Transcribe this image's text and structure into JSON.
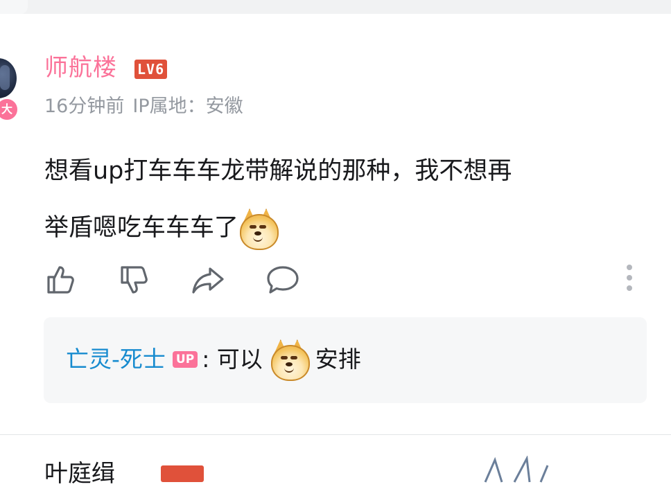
{
  "comment": {
    "username": "师航楼",
    "level": "LV6",
    "vip_badge": "大",
    "time": "16分钟前",
    "ip": "IP属地：安徽",
    "content_line1": "想看up打车车车龙带解说的那种，我不想再",
    "content_line2": "举盾嗯吃车车车了",
    "emoji": "doge-emoji"
  },
  "actions": {
    "like": "thumbs-up-icon",
    "dislike": "thumbs-down-icon",
    "share": "share-icon",
    "reply": "comment-icon",
    "more": "more-vertical-icon"
  },
  "reply": {
    "username": "亡灵-死士",
    "up_tag": "UP",
    "text_before": ": 可以",
    "text_after": "安排"
  },
  "next_comment": {
    "username_partial": "叶庭缉"
  },
  "colors": {
    "username_pink": "#fb7299",
    "level_red": "#e0513a",
    "reply_user_blue": "#178bcf",
    "meta_gray": "#9499a0",
    "reply_bg": "#f6f7f8"
  }
}
